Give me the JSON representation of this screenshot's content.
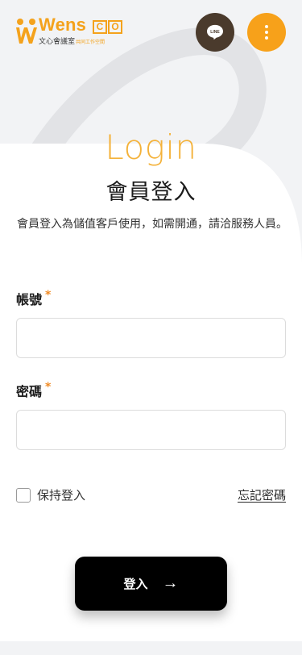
{
  "brand": {
    "name": "Wens",
    "co_letters": [
      "C",
      "O"
    ],
    "subtitle": "文心會議室",
    "subtitle_small": "共同工作空間",
    "accent_color": "#f4a21c"
  },
  "header": {
    "line_button_text": "LINE",
    "line_button_icon": "line-chat-icon",
    "menu_button_icon": "vertical-dots-icon"
  },
  "page": {
    "title_en": "Login",
    "title_zh": "會員登入",
    "description": "會員登入為儲值客戶使用，如需開通，請洽服務人員。"
  },
  "form": {
    "account_label": "帳號",
    "password_label": "密碼",
    "required_mark": "*",
    "account_value": "",
    "password_value": "",
    "remember_label": "保持登入",
    "remember_checked": false,
    "forgot_link": "忘記密碼",
    "submit_label": "登入",
    "submit_arrow": "→"
  },
  "colors": {
    "background": "#f2f3f5",
    "line_button": "#4a3a2c",
    "menu_button": "#f7a11a",
    "submit": "#000000"
  }
}
